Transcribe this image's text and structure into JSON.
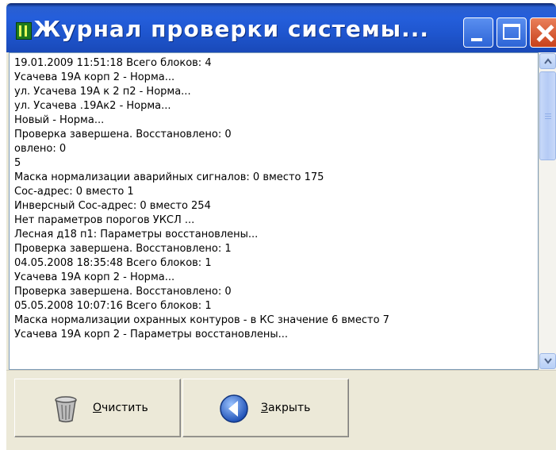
{
  "window": {
    "title": "Журнал проверки системы...",
    "accent": "#245edb"
  },
  "log": {
    "lines": [
      "19.01.2009 11:51:18  Всего блоков: 4",
      "Усачева 19А корп 2 - Норма...",
      "ул. Усачева 19А к 2 п2 - Норма...",
      "ул. Усачева .19Ак2 - Норма...",
      "Новый - Норма...",
      "Проверка завершена. Восстановлено: 0",
      "овлено: 0",
      "5",
      "Маска нормализации аварийных сигналов: 0 вместо 175",
      "Сос-адрес: 0 вместо 1",
      "Инверсный Сос-адрес: 0 вместо 254",
      "Нет параметров порогов УКСЛ ...",
      "Лесная д18 п1: Параметры восстановлены...",
      "Проверка завершена. Восстановлено: 1",
      "04.05.2008 18:35:48  Всего блоков: 1",
      "Усачева 19А корп 2 - Норма...",
      "Проверка завершена. Восстановлено: 0",
      "05.05.2008 10:07:16  Всего блоков: 1",
      "Маска нормализации охранных контуров - в КС значение 6 вместо 7",
      "Усачева 19А корп 2 - Параметры восстановлены..."
    ],
    "scroll_position": 0.1
  },
  "buttons": {
    "clear": {
      "mnemonic": "О",
      "rest": "чистить",
      "icon": "trash-can-icon"
    },
    "close": {
      "mnemonic": "З",
      "rest": "акрыть",
      "icon": "back-arrow-icon"
    }
  }
}
